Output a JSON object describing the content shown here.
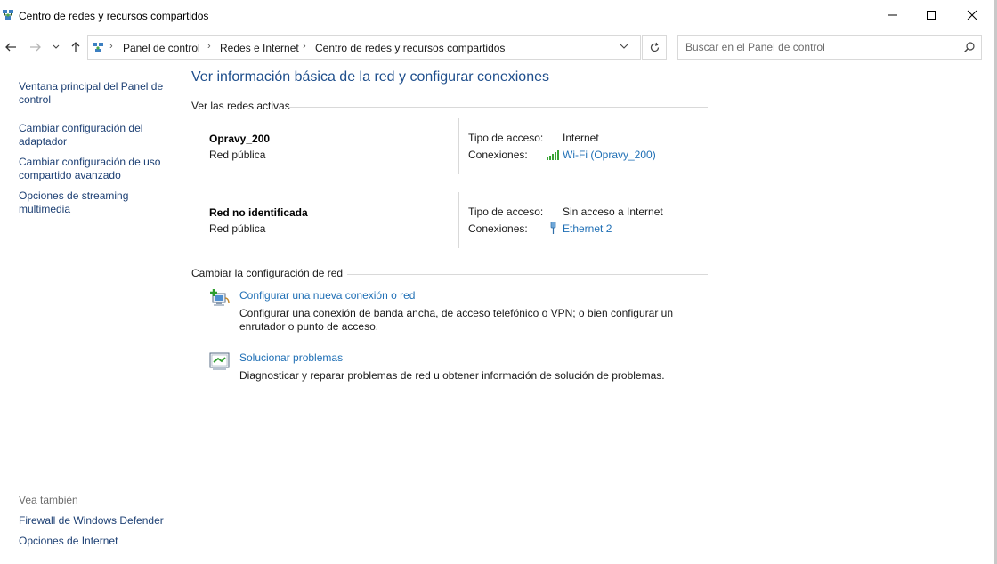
{
  "window": {
    "title": "Centro de redes y recursos compartidos",
    "controls": {
      "minimize": "—",
      "maximize": "☐",
      "close": "✕"
    }
  },
  "address_bar": {
    "breadcrumbs": [
      "Panel de control",
      "Redes e Internet",
      "Centro de redes y recursos compartidos"
    ],
    "search_placeholder": "Buscar en el Panel de control"
  },
  "left_pane": {
    "links": [
      "Ventana principal del Panel de control",
      "Cambiar configuración del adaptador",
      "Cambiar configuración de uso compartido avanzado",
      "Opciones de streaming multimedia"
    ],
    "see_also_heading": "Vea también",
    "see_also_links": [
      "Firewall de Windows Defender",
      "Opciones de Internet"
    ]
  },
  "main": {
    "title": "Ver información básica de la red y configurar conexiones",
    "active_networks_heading": "Ver las redes activas",
    "networks": [
      {
        "name": "Opravy_200",
        "type": "Red pública",
        "access_label": "Tipo de acceso:",
        "access_value": "Internet",
        "connections_label": "Conexiones:",
        "connection": "Wi-Fi (Opravy_200)",
        "connection_icon": "wifi-signal-icon"
      },
      {
        "name": "Red no identificada",
        "type": "Red pública",
        "access_label": "Tipo de acceso:",
        "access_value": "Sin acceso a Internet",
        "connections_label": "Conexiones:",
        "connection": "Ethernet 2",
        "connection_icon": "ethernet-icon"
      }
    ],
    "change_settings_heading": "Cambiar la configuración de red",
    "tasks": [
      {
        "link": "Configurar una nueva conexión o red",
        "description": "Configurar una conexión de banda ancha, de acceso telefónico o VPN; o bien configurar un enrutador o punto de acceso.",
        "icon": "new-connection-icon"
      },
      {
        "link": "Solucionar problemas",
        "description": "Diagnosticar y reparar problemas de red u obtener información de solución de problemas.",
        "icon": "troubleshoot-icon"
      }
    ]
  },
  "colors": {
    "title_blue": "#1e4e8c",
    "link_blue": "#1f6fb5",
    "nav_link": "#1c3f73",
    "wifi_green": "#3aa335"
  }
}
